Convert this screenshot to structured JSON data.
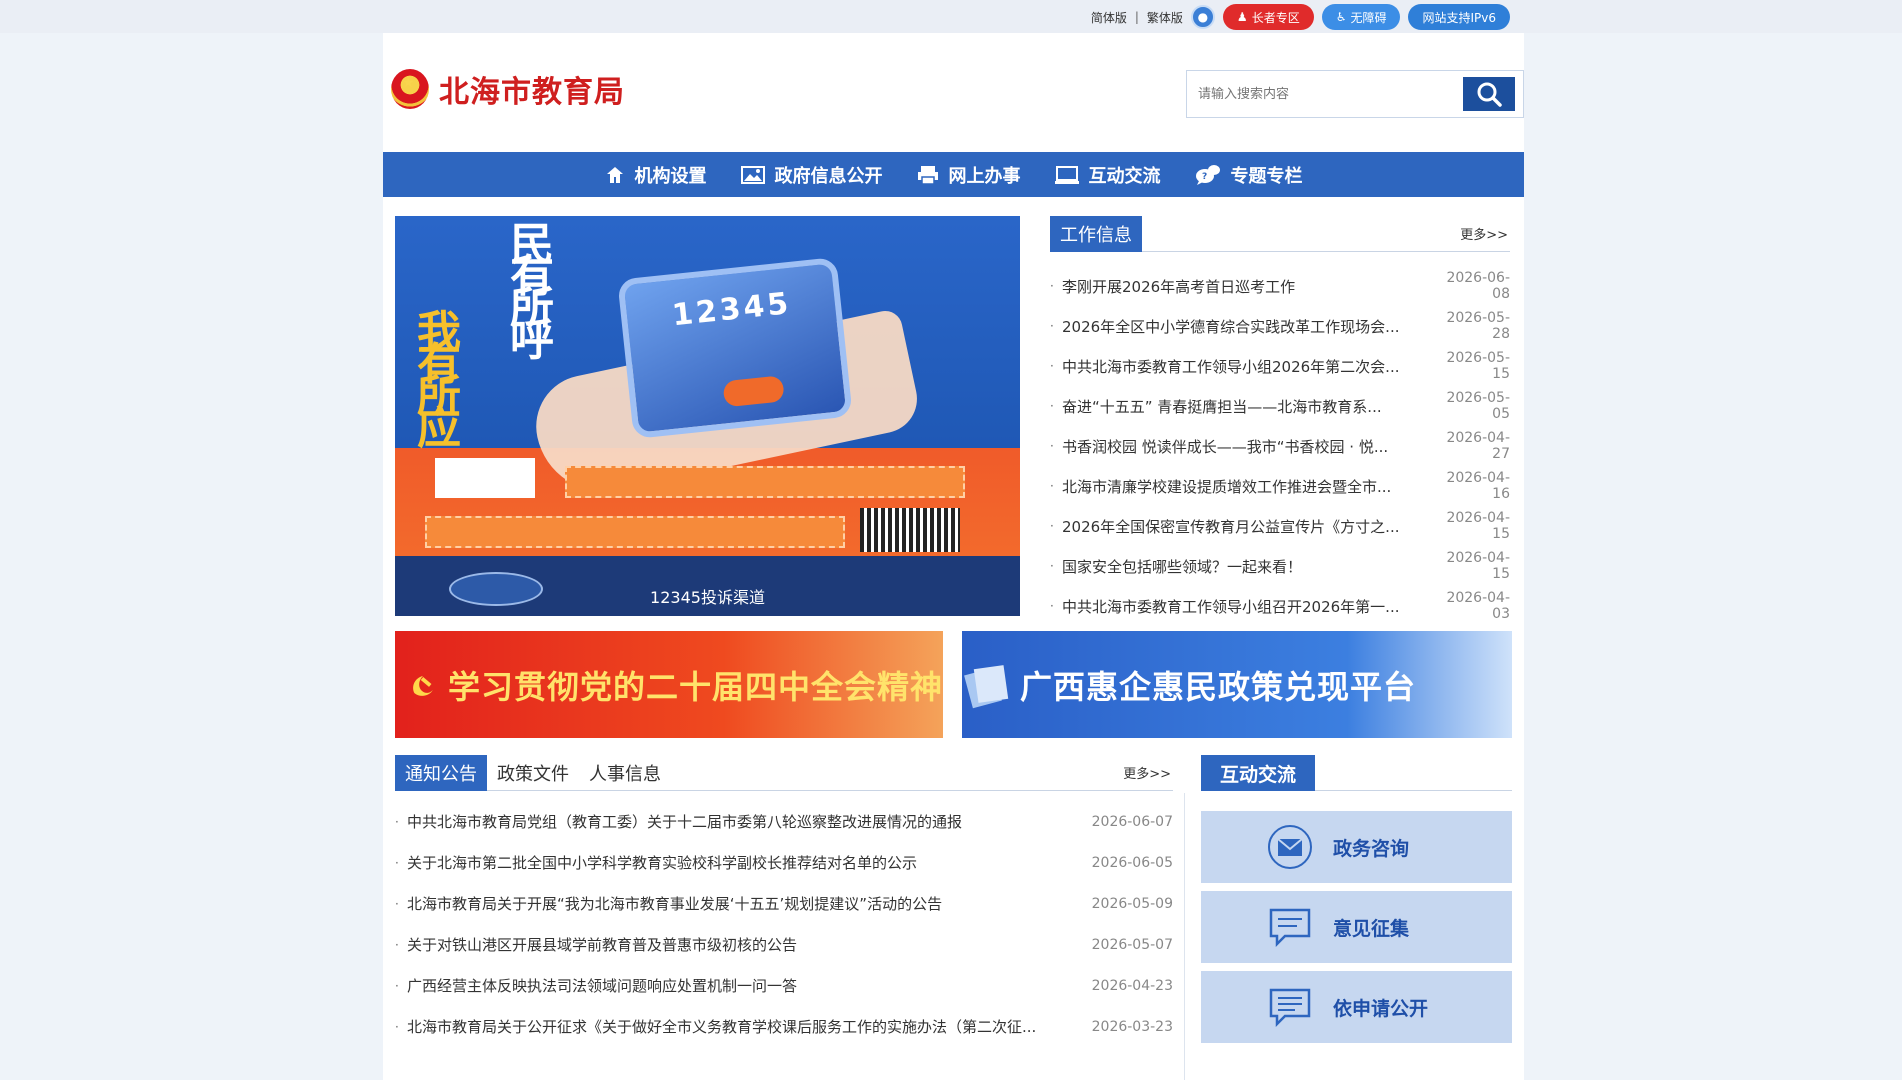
{
  "topbar": {
    "simplified": "简体版",
    "separator": "|",
    "traditional": "繁体版",
    "elder": "长者专区",
    "barrier_free": "无障碍",
    "ipv6": "网站支持IPv6"
  },
  "header": {
    "site_title": "北海市教育局",
    "search_placeholder": "请输入搜索内容"
  },
  "nav": {
    "items": [
      {
        "label": "机构设置",
        "icon": "home-icon"
      },
      {
        "label": "政府信息公开",
        "icon": "picture-icon"
      },
      {
        "label": "网上办事",
        "icon": "printer-icon"
      },
      {
        "label": "互动交流",
        "icon": "monitor-icon"
      },
      {
        "label": "专题专栏",
        "icon": "chat-bubble-icon"
      }
    ]
  },
  "banner": {
    "phone_number": "12345",
    "chars_right": [
      "民",
      "有",
      "所",
      "呼"
    ],
    "chars_left": [
      "我",
      "有",
      "所",
      "应"
    ],
    "caption": "12345投诉渠道"
  },
  "work_info": {
    "title": "工作信息",
    "more": "更多>>",
    "items": [
      {
        "title": "李刚开展2026年高考首日巡考工作",
        "date": "2026-06-08"
      },
      {
        "title": "2026年全区中小学德育综合实践改革工作现场会...",
        "date": "2026-05-28"
      },
      {
        "title": "中共北海市委教育工作领导小组2026年第二次会...",
        "date": "2026-05-15"
      },
      {
        "title": "奋进“十五五” 青春挺膺担当——北海市教育系...",
        "date": "2026-05-05"
      },
      {
        "title": "书香润校园 悦读伴成长——我市“书香校园 · 悦...",
        "date": "2026-04-27"
      },
      {
        "title": "北海市清廉学校建设提质增效工作推进会暨全市...",
        "date": "2026-04-16"
      },
      {
        "title": "2026年全国保密宣传教育月公益宣传片《方寸之...",
        "date": "2026-04-15"
      },
      {
        "title": "国家安全包括哪些领域？一起来看！",
        "date": "2026-04-15"
      },
      {
        "title": "中共北海市委教育工作领导小组召开2026年第一...",
        "date": "2026-04-03"
      }
    ]
  },
  "promos": {
    "left": "学习贯彻党的二十届四中全会精神",
    "right": "广西惠企惠民政策兑现平台"
  },
  "notice": {
    "tabs": [
      "通知公告",
      "政策文件",
      "人事信息"
    ],
    "more": "更多>>",
    "items": [
      {
        "title": "中共北海市教育局党组（教育工委）关于十二届市委第八轮巡察整改进展情况的通报",
        "date": "2026-06-07"
      },
      {
        "title": "关于北海市第二批全国中小学科学教育实验校科学副校长推荐结对名单的公示",
        "date": "2026-06-05"
      },
      {
        "title": "北海市教育局关于开展“我为北海市教育事业发展‘十五五’规划提建议”活动的公告",
        "date": "2026-05-09"
      },
      {
        "title": "关于对铁山港区开展县域学前教育普及普惠市级初核的公告",
        "date": "2026-05-07"
      },
      {
        "title": "广西经营主体反映执法司法领域问题响应处置机制一问一答",
        "date": "2026-04-23"
      },
      {
        "title": "北海市教育局关于公开征求《关于做好全市义务教育学校课后服务工作的实施办法（第二次征...",
        "date": "2026-03-23"
      }
    ]
  },
  "interact": {
    "title": "互动交流",
    "buttons": [
      {
        "label": "政务咨询",
        "icon": "envelope-icon"
      },
      {
        "label": "意见征集",
        "icon": "message-icon"
      },
      {
        "label": "依申请公开",
        "icon": "message-lines-icon"
      }
    ]
  },
  "colors": {
    "primary": "#2e66bf",
    "title_red": "#cf1f1f",
    "background": "#eef3f9"
  }
}
